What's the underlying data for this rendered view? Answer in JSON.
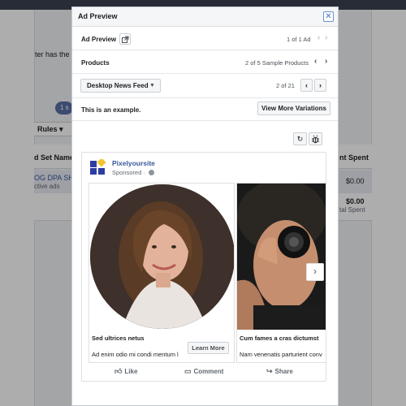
{
  "background": {
    "fragment_text": "ter has the m",
    "pill_text": "1 s",
    "rules_label": "Rules",
    "col_ad_set": "d Set Name",
    "col_spent": "nt Spent",
    "row1_name": "OG DPA SHO",
    "row1_status": "ctive ads",
    "row1_amount": "$0.00",
    "row2_amount": "$0.00",
    "row2_sub": "tal Spent"
  },
  "modal": {
    "title": "Ad Preview",
    "close_icon": "close-icon",
    "ad_preview_label": "Ad Preview",
    "ad_count": "1 of 1 Ad",
    "products_label": "Products",
    "products_count": "2 of 5 Sample Products",
    "placement": "Desktop News Feed",
    "placement_count": "2 of 21",
    "example_text": "This is an example.",
    "variations_button": "View More Variations"
  },
  "ad": {
    "page_name": "Pixelyoursite",
    "sponsored": "Sponsored ·",
    "cards": [
      {
        "title": "Sed ultrices netus",
        "description": "Ad enim odio mi condi mentum l",
        "cta": "Learn More"
      },
      {
        "title": "Cum fames a cras dictumst",
        "description": "Nam venenatis parturient conv"
      }
    ],
    "actions": {
      "like": "Like",
      "comment": "Comment",
      "share": "Share"
    }
  },
  "colors": {
    "link": "#385898",
    "accent": "#4a6fc4"
  }
}
